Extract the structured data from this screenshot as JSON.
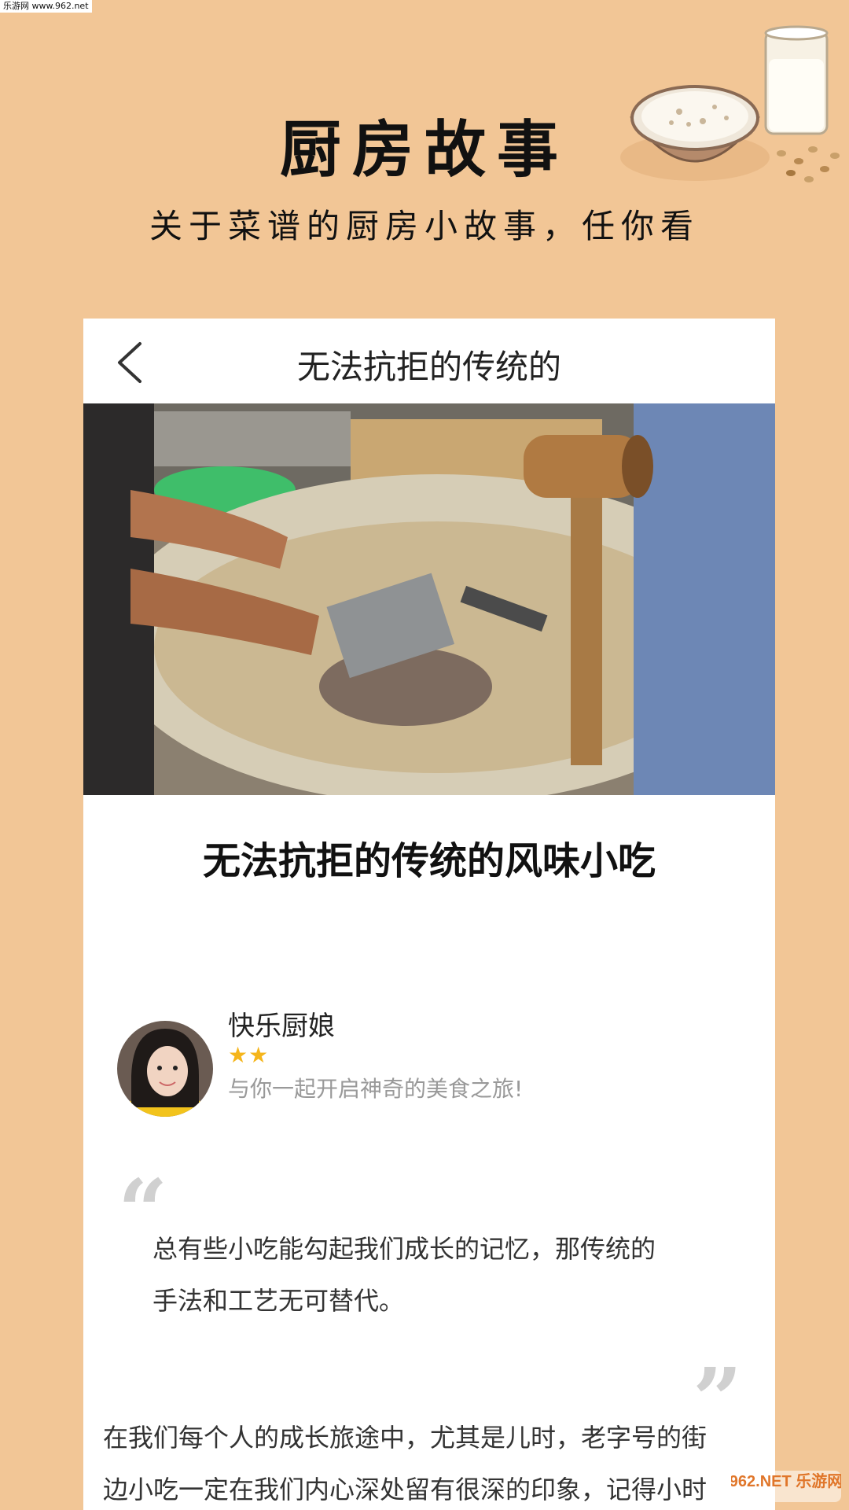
{
  "watermark_top": "乐游网 www.962.net",
  "promo": {
    "title": "厨房故事",
    "subtitle": "关于菜谱的厨房小故事，任你看"
  },
  "nav": {
    "back_icon": "chevron-left-icon",
    "title": "无法抗拒的传统的"
  },
  "article": {
    "title": "无法抗拒的传统的风味小吃",
    "author": {
      "name": "快乐厨娘",
      "stars": 2,
      "stars_text": "★★",
      "motto": "与你一起开启神奇的美食之旅!"
    },
    "quote_open_mark": "“",
    "quote_close_mark": "”",
    "quote_line1": "总有些小吃能勾起我们成长的记忆，那传统的",
    "quote_line2": "手法和工艺无可替代。",
    "body_line1": "在我们每个人的成长旅途中，尤其是儿时，老字号的街",
    "body_line2": "边小吃一定在我们内心深处留有很深的印象，记得小时"
  },
  "watermark_bottom": "962.NET 乐游网",
  "colors": {
    "background": "#F2C696",
    "card": "#FFFFFF",
    "star": "#F5B51B"
  }
}
